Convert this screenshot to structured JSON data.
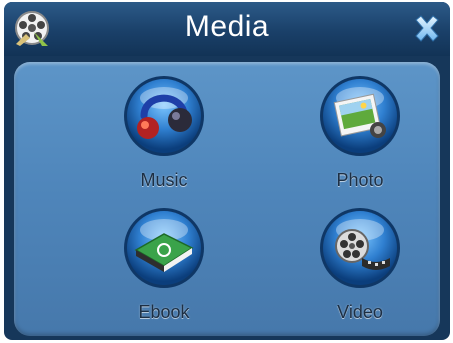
{
  "window": {
    "title": "Media",
    "app_icon": "film-reel-icon",
    "close_icon": "close-icon"
  },
  "menu": {
    "items": [
      {
        "id": "music",
        "label": "Music",
        "icon": "music-headphones-icon"
      },
      {
        "id": "photo",
        "label": "Photo",
        "icon": "photo-icon"
      },
      {
        "id": "ebook",
        "label": "Ebook",
        "icon": "ebook-icon"
      },
      {
        "id": "video",
        "label": "Video",
        "icon": "video-film-reel-icon"
      }
    ]
  },
  "colors": {
    "titlebar": "#1a4069",
    "panel": "#4f86bb",
    "orb": "#2f7fd0",
    "label": "#1d2f44"
  }
}
